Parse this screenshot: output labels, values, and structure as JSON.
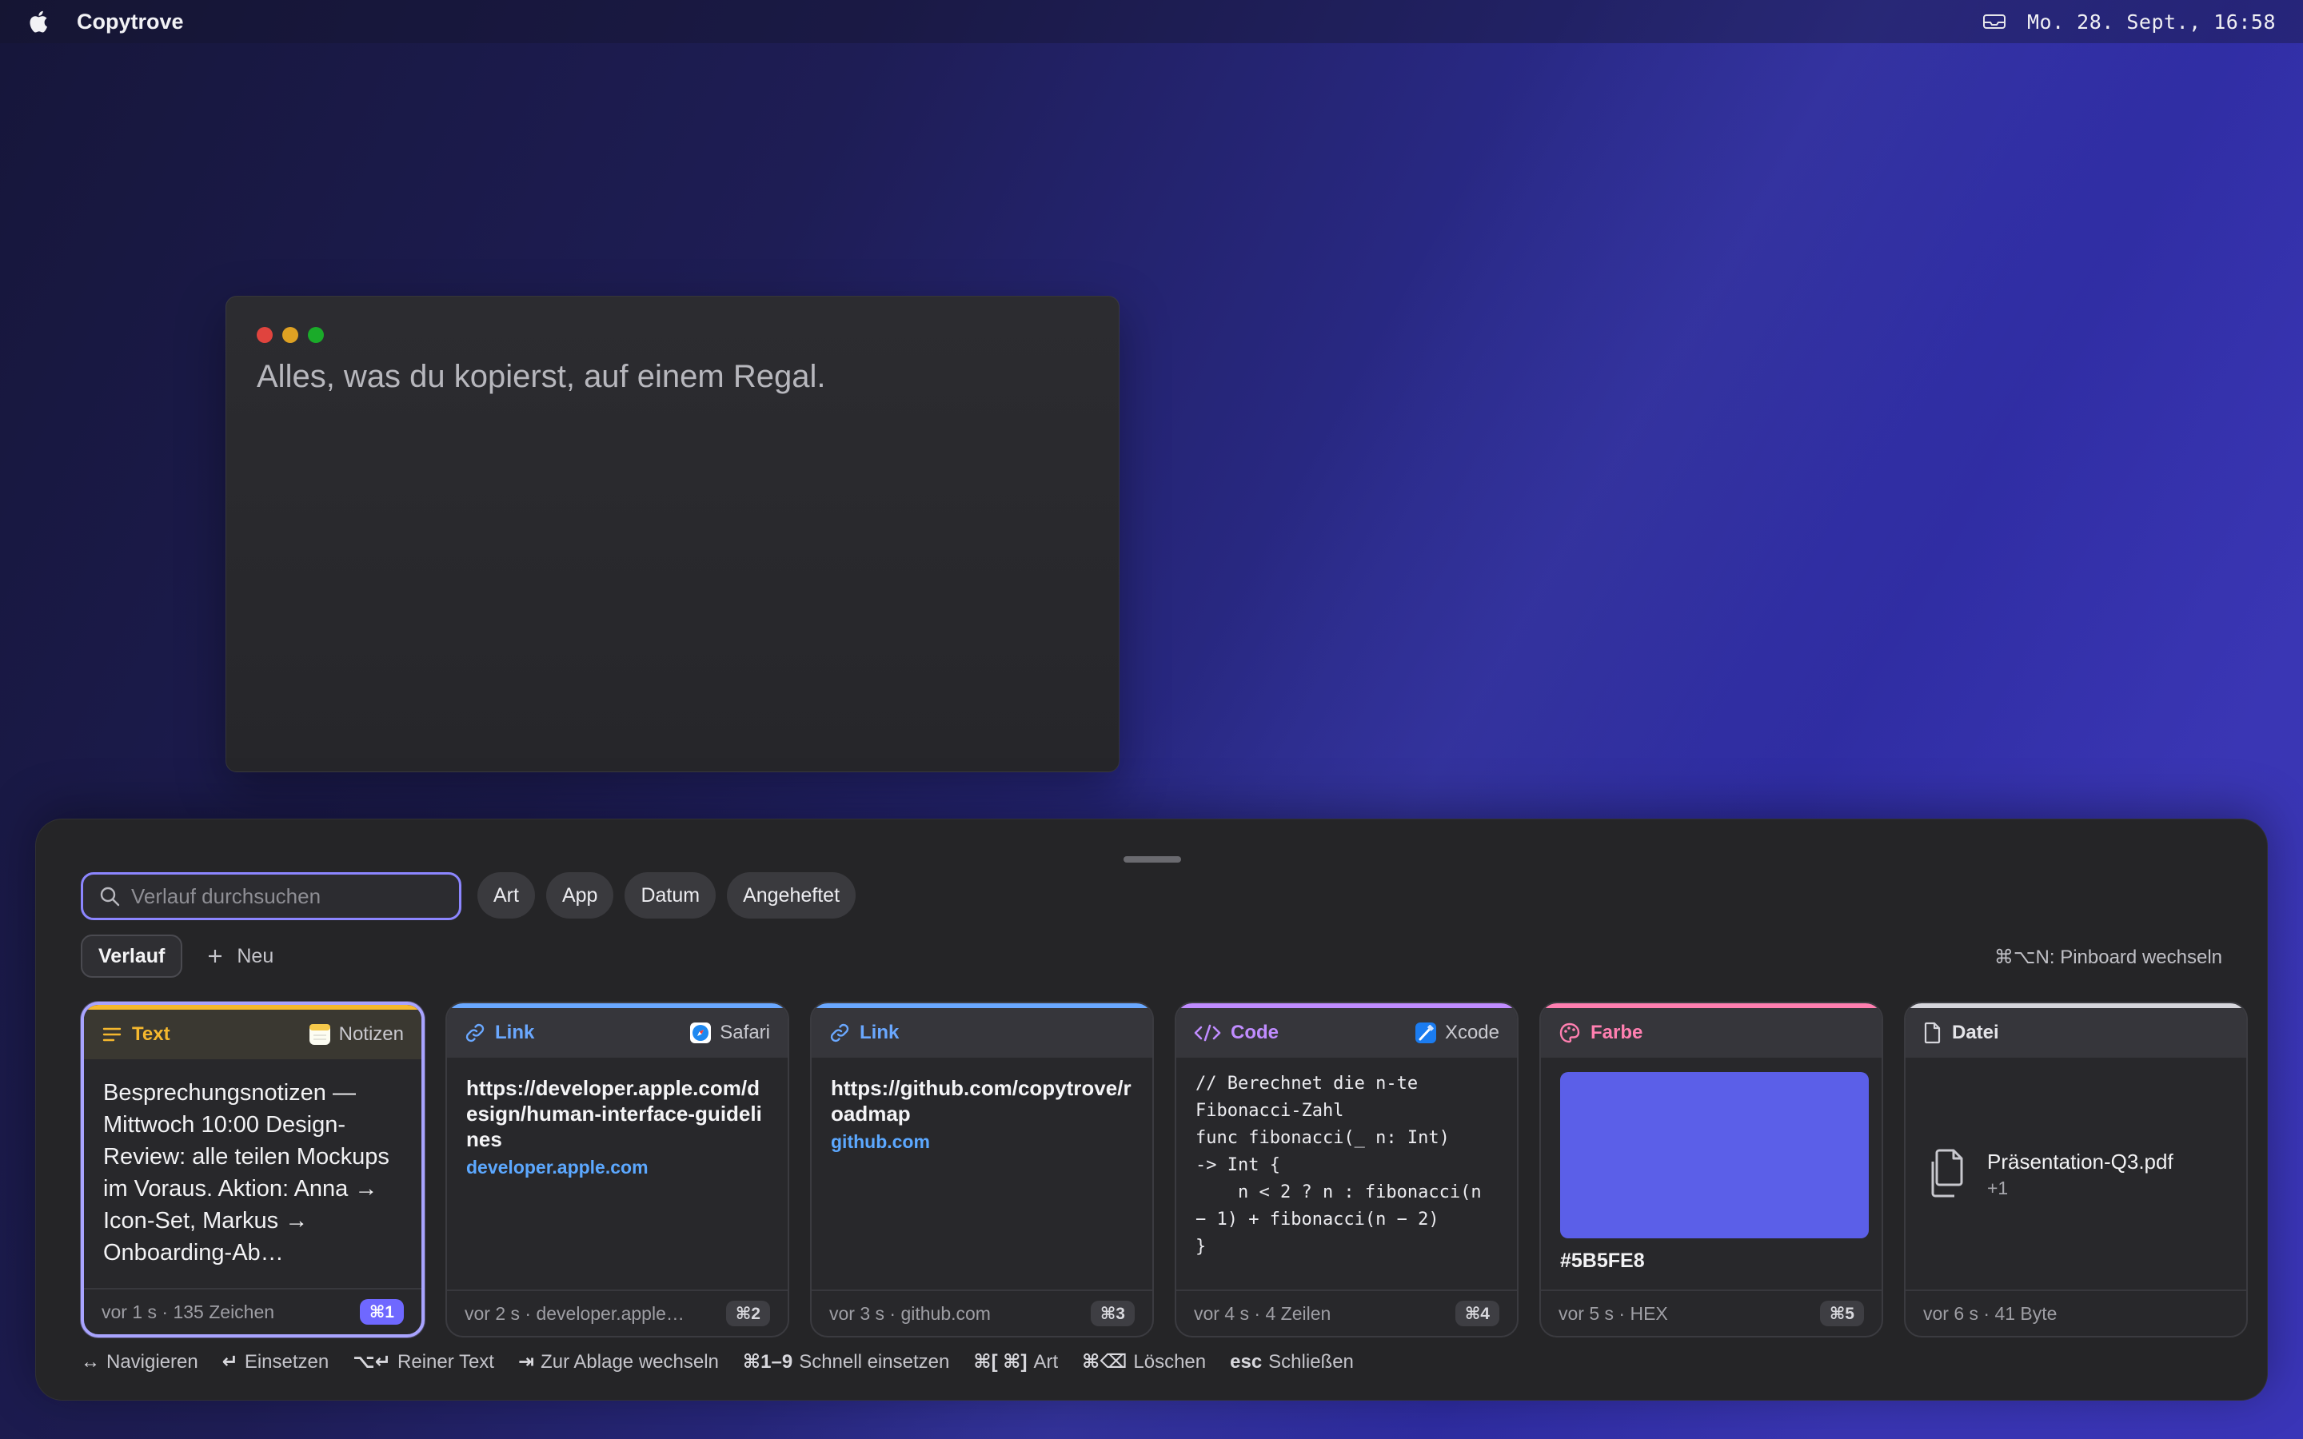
{
  "menubar": {
    "app_name": "Copytrove",
    "clock": "Mo. 28. Sept., 16:58"
  },
  "window": {
    "headline": "Alles, was du kopierst, auf einem Regal."
  },
  "panel": {
    "search": {
      "placeholder": "Verlauf durchsuchen"
    },
    "filters": [
      "Art",
      "App",
      "Datum",
      "Angeheftet"
    ],
    "tabs": {
      "active": "Verlauf",
      "new_label": "Neu"
    },
    "pinboard_hint": "⌘⌥N: Pinboard wechseln",
    "cards": [
      {
        "kind": "Text",
        "kind_color": "#f5b82e",
        "source_app": "Notizen",
        "content": "Besprechungsnotizen — Mittwoch 10:00 Design-Review: alle teilen Mockups im Voraus. Aktion: Anna → Icon-Set, Markus → Onboarding-Ab…",
        "meta": "vor 1 s · 135 Zeichen",
        "shortcut": "⌘1"
      },
      {
        "kind": "Link",
        "kind_color": "#6aa8ff",
        "source_app": "Safari",
        "url": "https://developer.apple.com/design/human-interface-guidelines",
        "host": "developer.apple.com",
        "meta": "vor 2 s · developer.apple…",
        "shortcut": "⌘2"
      },
      {
        "kind": "Link",
        "kind_color": "#6aa8ff",
        "url": "https://github.com/copytrove/roadmap",
        "host": "github.com",
        "meta": "vor 3 s · github.com",
        "shortcut": "⌘3"
      },
      {
        "kind": "Code",
        "kind_color": "#c08cff",
        "source_app": "Xcode",
        "code": "// Berechnet die n-te\nFibonacci-Zahl\nfunc fibonacci(_ n: Int)\n-> Int {\n    n < 2 ? n : fibonacci(n\n− 1) + fibonacci(n − 2)\n}",
        "meta": "vor 4 s · 4 Zeilen",
        "shortcut": "⌘4"
      },
      {
        "kind": "Farbe",
        "kind_color": "#ff7fb0",
        "color_value": "#5B5FE8",
        "hex_label": "#5B5FE8",
        "meta": "vor 5 s · HEX",
        "shortcut": "⌘5"
      },
      {
        "kind": "Datei",
        "kind_color": "#d6d6dc",
        "file_name": "Präsentation-Q3.pdf",
        "file_extra": "+1",
        "meta": "vor 6 s · 41 Byte"
      }
    ],
    "shortcuts": [
      {
        "key": "↔",
        "label": "Navigieren"
      },
      {
        "key": "↵",
        "label": "Einsetzen"
      },
      {
        "key": "⌥↵",
        "label": "Reiner Text"
      },
      {
        "key": "⇥",
        "label": "Zur Ablage wechseln"
      },
      {
        "key": "⌘1–9",
        "label": "Schnell einsetzen"
      },
      {
        "key": "⌘[ ⌘]",
        "label": "Art"
      },
      {
        "key": "⌘⌫",
        "label": "Löschen"
      },
      {
        "key": "esc",
        "label": "Schließen"
      }
    ]
  }
}
